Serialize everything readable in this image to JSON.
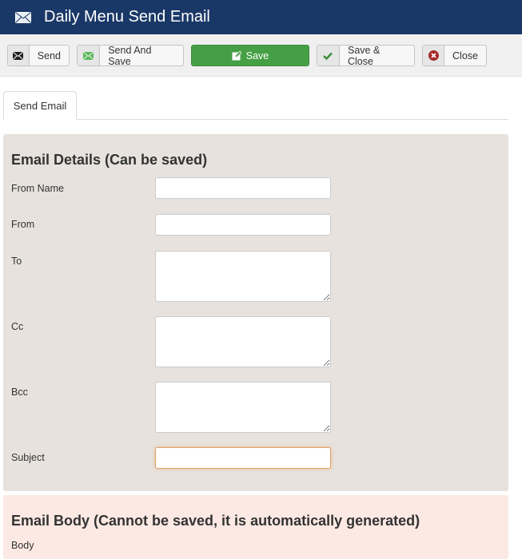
{
  "header": {
    "title": "Daily Menu Send Email",
    "icon": "envelope-icon"
  },
  "toolbar": {
    "send": {
      "label": "Send",
      "icon": "envelope-icon"
    },
    "send_and_save": {
      "label": "Send And Save",
      "icon": "envelope-green-icon"
    },
    "save": {
      "label": "Save",
      "icon": "edit-icon"
    },
    "save_close": {
      "label": "Save & Close",
      "icon": "checkmark-icon"
    },
    "close": {
      "label": "Close",
      "icon": "close-circle-icon"
    }
  },
  "tabs": [
    {
      "label": "Send Email",
      "active": true
    }
  ],
  "details": {
    "heading": "Email Details (Can be saved)",
    "fields": {
      "from_name": {
        "label": "From Name",
        "value": ""
      },
      "from": {
        "label": "From",
        "value": ""
      },
      "to": {
        "label": "To",
        "value": ""
      },
      "cc": {
        "label": "Cc",
        "value": ""
      },
      "bcc": {
        "label": "Bcc",
        "value": ""
      },
      "subject": {
        "label": "Subject",
        "value": ""
      }
    }
  },
  "body": {
    "heading": "Email Body (Cannot be saved, it is automatically generated)",
    "label": "Body"
  },
  "colors": {
    "header_bg": "#1a3867",
    "primary": "#45a045",
    "details_bg": "#e7e2dd",
    "body_bg": "#fde9e3"
  }
}
